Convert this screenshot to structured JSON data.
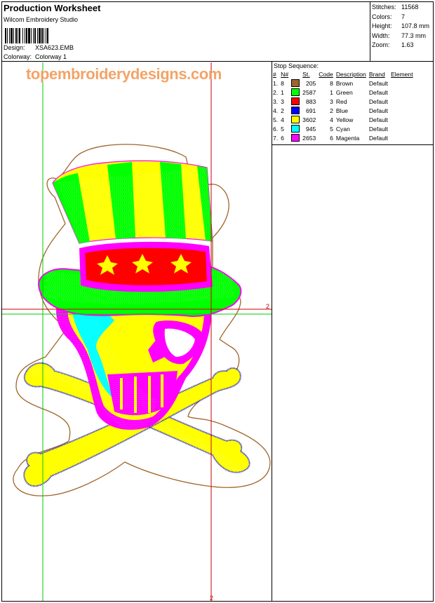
{
  "header": {
    "title": "Production Worksheet",
    "software": "Wilcom Embroidery Studio",
    "design_label": "Design:",
    "design_value": "XSA623.EMB",
    "colorway_label": "Colorway:",
    "colorway_value": "Colorway 1"
  },
  "stats": [
    {
      "label": "Stitches:",
      "value": "11568"
    },
    {
      "label": "Colors:",
      "value": "7"
    },
    {
      "label": "Height:",
      "value": "107.8 mm"
    },
    {
      "label": "Width:",
      "value": "77.3 mm"
    },
    {
      "label": "Zoom:",
      "value": "1.63"
    }
  ],
  "stop_sequence": {
    "title": "Stop Sequence:",
    "columns": [
      "#",
      "N#",
      "St.",
      "Code",
      "Description",
      "Brand",
      "Element"
    ],
    "rows": [
      {
        "num": "1.",
        "n": "8",
        "st": "205",
        "code": "8",
        "desc": "Brown",
        "brand": "Default",
        "color": "#a0652a"
      },
      {
        "num": "2.",
        "n": "1",
        "st": "2587",
        "code": "1",
        "desc": "Green",
        "brand": "Default",
        "color": "#00ff00"
      },
      {
        "num": "3.",
        "n": "3",
        "st": "883",
        "code": "3",
        "desc": "Red",
        "brand": "Default",
        "color": "#ff0000"
      },
      {
        "num": "4.",
        "n": "2",
        "st": "691",
        "code": "2",
        "desc": "Blue",
        "brand": "Default",
        "color": "#0000ff"
      },
      {
        "num": "5.",
        "n": "4",
        "st": "3602",
        "code": "4",
        "desc": "Yellow",
        "brand": "Default",
        "color": "#ffff00"
      },
      {
        "num": "6.",
        "n": "5",
        "st": "945",
        "code": "5",
        "desc": "Cyan",
        "brand": "Default",
        "color": "#00ffff"
      },
      {
        "num": "7.",
        "n": "6",
        "st": "2653",
        "code": "6",
        "desc": "Magenta",
        "brand": "Default",
        "color": "#ff00ff"
      }
    ]
  },
  "watermark": "topembroiderydesigns.com",
  "guides": {
    "label_right": "2",
    "label_bottom": "2"
  },
  "colors": {
    "guide_red": "#cc0000",
    "guide_green": "#00cc00",
    "outline_brown": "#a0652a"
  }
}
